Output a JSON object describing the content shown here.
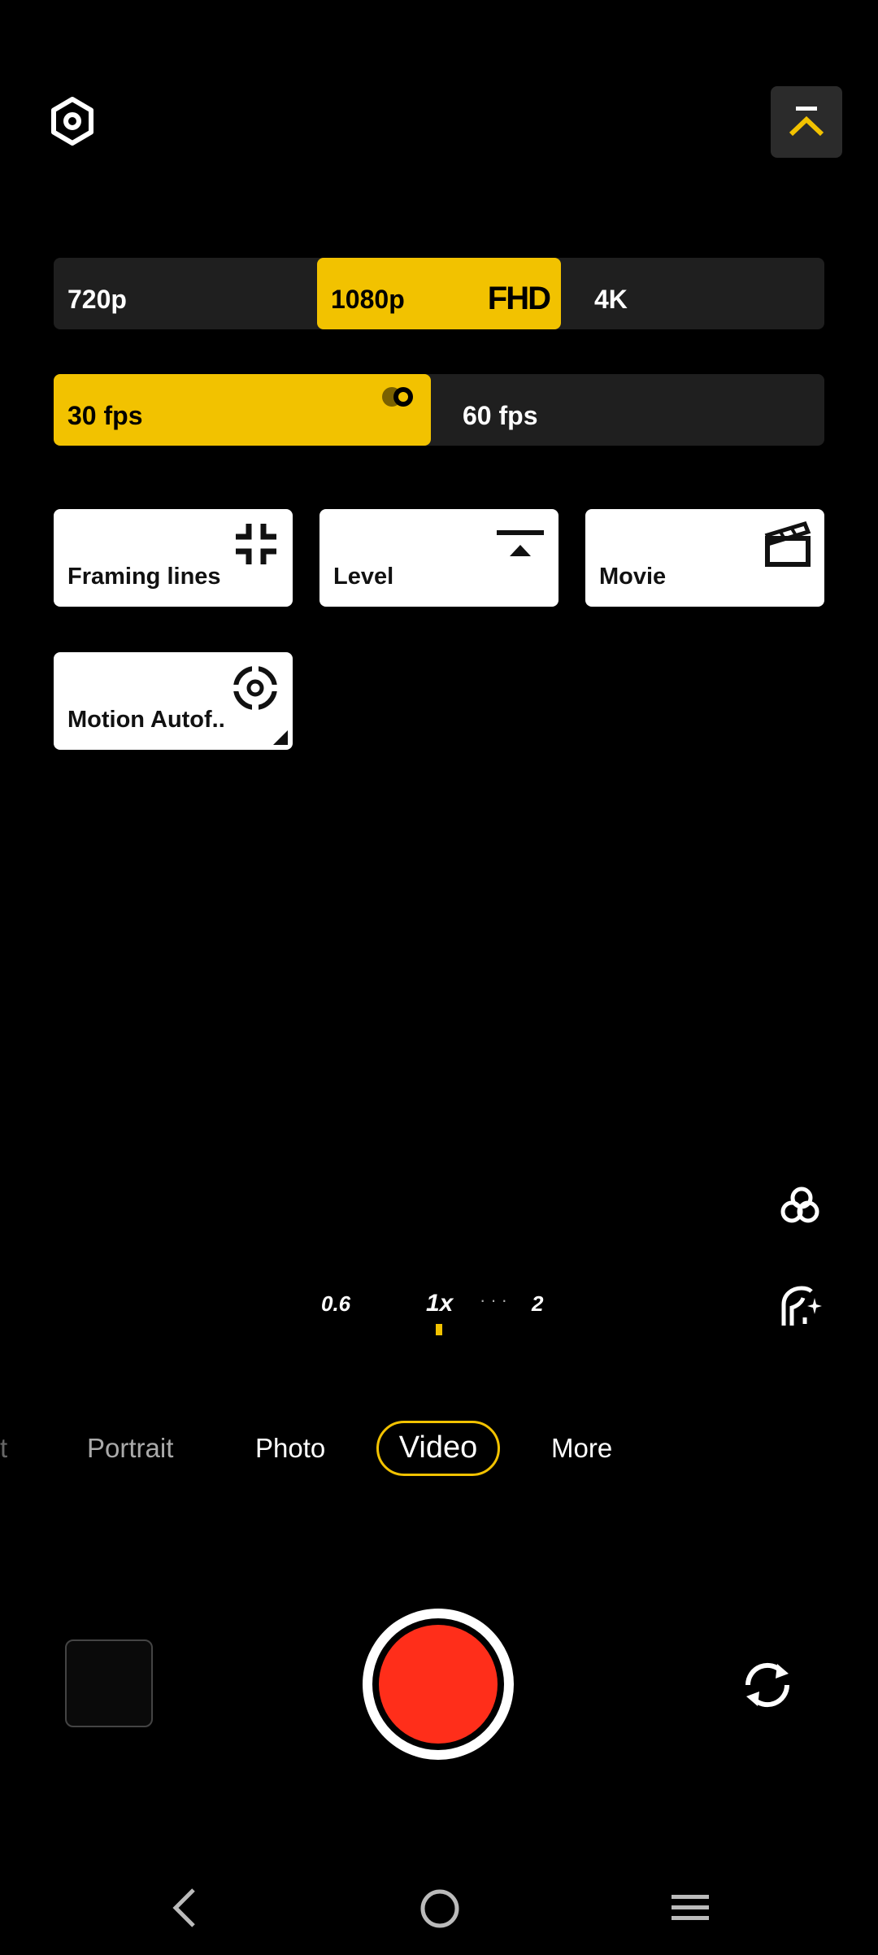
{
  "icons": {
    "settings": "hexagon-gear-icon",
    "collapse": "chevron-up-bar-icon",
    "framing": "framing-lines-icon",
    "level": "level-icon",
    "movie": "clapperboard-icon",
    "motion": "motion-autofocus-icon",
    "filters": "filters-icon",
    "beauty": "beauty-icon",
    "flip": "switch-camera-icon"
  },
  "resolution": {
    "options": [
      {
        "label": "720p",
        "selected": false
      },
      {
        "label": "1080p",
        "selected": true,
        "badge": "FHD"
      },
      {
        "label": "4K",
        "selected": false
      }
    ]
  },
  "framerate": {
    "options": [
      {
        "label": "30 fps",
        "selected": true
      },
      {
        "label": "60 fps",
        "selected": false
      }
    ]
  },
  "toggles": {
    "framing": "Framing lines",
    "level": "Level",
    "movie": "Movie",
    "motion": "Motion Autof.."
  },
  "zoom": {
    "wide": "0.6",
    "main": "1x",
    "tele": "2",
    "dots": "···"
  },
  "modes": {
    "cut": "t",
    "portrait": "Portrait",
    "photo": "Photo",
    "video": "Video",
    "more": "More"
  },
  "colors": {
    "accent": "#f2c200",
    "record": "#ff2e1a",
    "panel": "#1f1f1f"
  }
}
